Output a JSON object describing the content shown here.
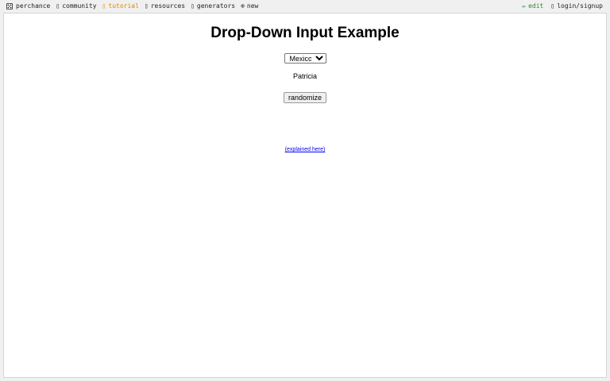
{
  "nav": {
    "brand": "perchance",
    "community": "community",
    "tutorial": "tutorial",
    "resources": "resources",
    "generators": "generators",
    "new": "new",
    "edit": "edit",
    "login": "login/signup",
    "icons": {
      "brand": "dice-icon",
      "community": "chat-icon",
      "tutorial": "book-icon",
      "resources": "box-icon",
      "generators": "list-icon",
      "new": "plus-circle-icon",
      "edit": "pencil-icon",
      "login": "user-icon"
    },
    "colors": {
      "active": "#e08a00",
      "edit": "#2a8a2a"
    }
  },
  "page": {
    "title": "Drop-Down Input Example",
    "select_value": "Mexico",
    "output_name": "Patricia",
    "randomize_label": "randomize",
    "explain_link": "(explained here)"
  }
}
